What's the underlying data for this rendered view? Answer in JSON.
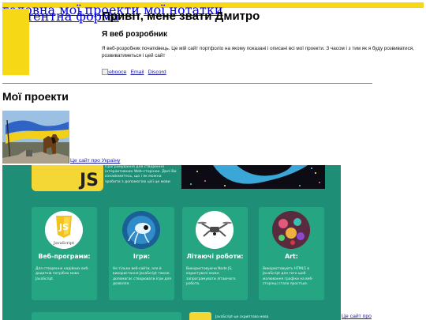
{
  "nav": {
    "items": [
      "головна",
      "мої проекти",
      "мої нотатки",
      "контентна форма"
    ]
  },
  "hero": {
    "title": "Привіт, мене звати Дмитро",
    "subtitle": "Я веб розробник",
    "description": "Я веб-розробник початківець. Це мій сайт портфоліо на якому показані і описані всі мої проекти. З часом і з тим як я буду розвиватися, розвиватиметься і цей сайт",
    "social": [
      "facebooce",
      "Email",
      "Discord"
    ]
  },
  "projects": {
    "title": "Мої проекти",
    "items": [
      {
        "link_text": "Це сайт про Україну"
      },
      {
        "link_text": "Це сайт про"
      }
    ]
  },
  "screenshot": {
    "js_badge": "JS",
    "intro_text": "Програмування для створення інтерактивних Web-сторінок. Далі Ви ознайомитесь, що і як можна зробити з допомогою цієї це мови",
    "cards": [
      {
        "title": "Веб-програми:",
        "badge": "JS",
        "caption": "JavaScript",
        "text": "Для створення надійних веб-додатків потрібна мова JavaScript."
      },
      {
        "title": "Ігри:",
        "text": "Не тільки веб-сайти, але й використання JavaScript також допомагає створювати ігри для дозвілля."
      },
      {
        "title": "Літаючі роботи:",
        "text": "Використовуючи Node JS, користувачі може запрограмувати літаючого робота."
      },
      {
        "title": "Art:",
        "text": "Використовують HTML5 в JavaScript для того щоб малювання графіки на веб-сторінці стало простіше."
      }
    ],
    "bottom_text": "JavaScript-це скриптова мова"
  },
  "colors": {
    "nav_bg": "#f7d816",
    "link": "#1b1ba0",
    "shot_bg": "#1e8f76",
    "card_bg": "#25a582",
    "js_yellow": "#f4d735"
  }
}
